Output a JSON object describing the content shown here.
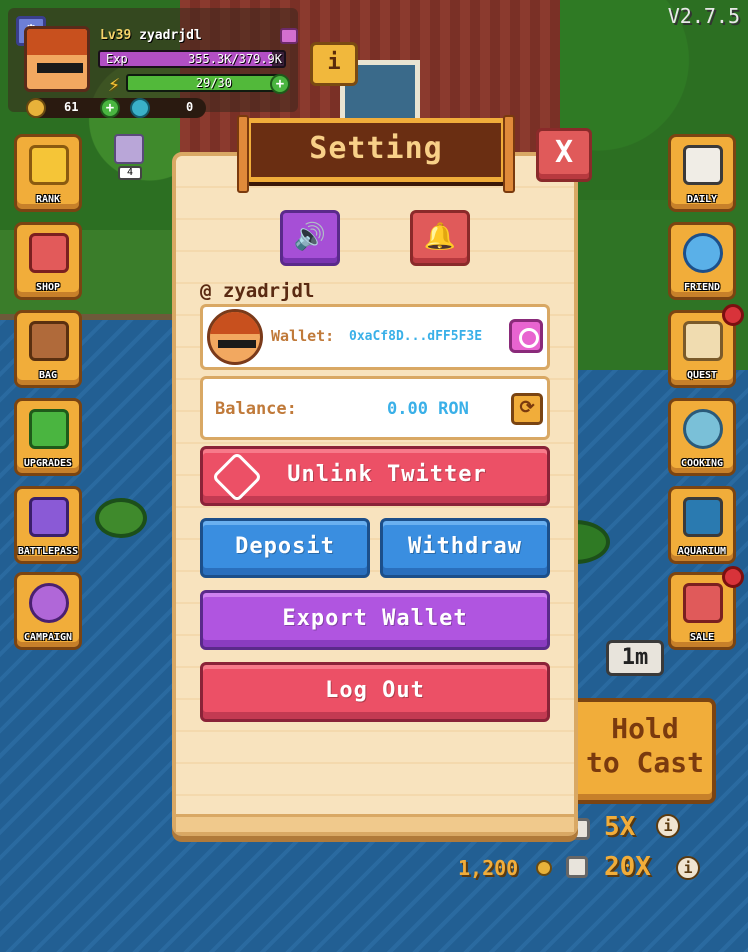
{
  "version": "V2.7.5",
  "player": {
    "level": "Lv39",
    "name": "zyadrjdl",
    "exp_label": "Exp",
    "exp_value": "355.3K/379.9K",
    "exp_progress": 0.935,
    "energy": "29/30",
    "energy_progress": 0.967,
    "coins": "61",
    "gems": "0"
  },
  "info_button": "i",
  "item_badge": "4",
  "left_menu": [
    "RANK",
    "SHOP",
    "BAG",
    "UPGRADES",
    "BATTLEPASS",
    "CAMPAIGN"
  ],
  "right_menu": [
    "DAILY",
    "FRIEND",
    "QUEST",
    "COOKING",
    "AQUARIUM",
    "SALE"
  ],
  "timer": "1m",
  "cast_button": "Hold\nto Cast",
  "multipliers": {
    "m1": "5X",
    "m2": "20X",
    "cost": "1,200"
  },
  "settings": {
    "title": "Setting",
    "close": "X",
    "username": "@ zyadrjdl",
    "wallet_label": "Wallet:",
    "wallet_address": "0xaCf8D...dFF5F3E",
    "balance_label": "Balance:",
    "balance_value": "0.00 RON",
    "unlink_twitter": "Unlink Twitter",
    "deposit": "Deposit",
    "withdraw": "Withdraw",
    "export_wallet": "Export Wallet",
    "log_out": "Log Out"
  },
  "colors": {
    "plank": "#6a2e12",
    "red_button": "#ec5066",
    "blue_button": "#3a8ee0",
    "purple_button": "#b055e0",
    "address": "#3ab0e8"
  }
}
